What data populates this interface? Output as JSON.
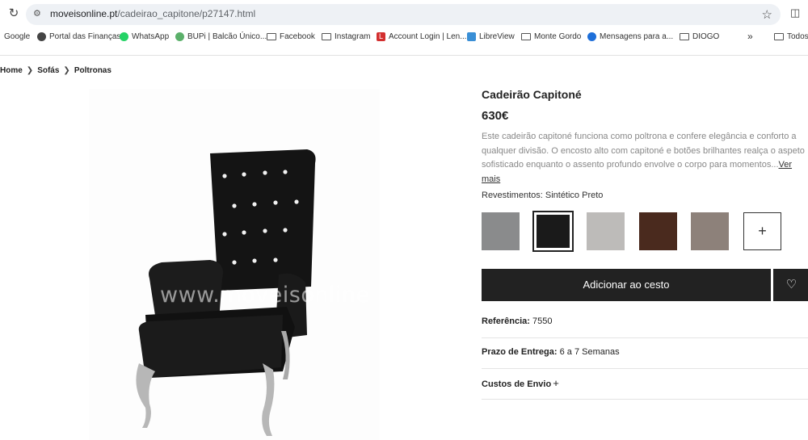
{
  "browser": {
    "url_host": "moveisonline.pt",
    "url_path": "/cadeirao_capitone/p27147.html",
    "bookmarks": [
      {
        "label": "Google"
      },
      {
        "label": "Portal das Finanças"
      },
      {
        "label": "WhatsApp"
      },
      {
        "label": "BUPi | Balcão Único..."
      },
      {
        "label": "Facebook"
      },
      {
        "label": "Instagram"
      },
      {
        "label": "Account Login | Len..."
      },
      {
        "label": "LibreView"
      },
      {
        "label": "Monte Gordo"
      },
      {
        "label": "Mensagens para a..."
      },
      {
        "label": "DIOGO"
      },
      {
        "label": "»"
      },
      {
        "label": "Todos"
      }
    ]
  },
  "breadcrumb": [
    "Home",
    "Sofás",
    "Poltronas"
  ],
  "image": {
    "watermark": "www.moveisonline"
  },
  "product": {
    "title": "Cadeirão Capitoné",
    "price": "630€",
    "description": "Este cadeirão capitoné funciona como poltrona e confere elegância e conforto a qualquer divisão. O encosto alto com capitoné e botões brilhantes realça o aspeto sofisticado enquanto o assento profundo envolve o corpo para momentos...",
    "more_link": "Ver mais",
    "finish_label": "Revestimentos: Sintético Preto",
    "swatches": [
      {
        "name": "cinza",
        "color": "#8a8b8c",
        "selected": false
      },
      {
        "name": "preto",
        "color": "#1a1a1a",
        "selected": true
      },
      {
        "name": "cinza-claro",
        "color": "#bdbbb9",
        "selected": false
      },
      {
        "name": "castanho",
        "color": "#4a2a1e",
        "selected": false
      },
      {
        "name": "taupe",
        "color": "#8d817a",
        "selected": false
      }
    ],
    "swatch_more": "+",
    "add_to_cart": "Adicionar ao cesto",
    "reference_label": "Referência:",
    "reference_value": "7550",
    "delivery_label": "Prazo de Entrega:",
    "delivery_value": "6 a 7 Semanas",
    "shipping_label": "Custos de Envio"
  }
}
